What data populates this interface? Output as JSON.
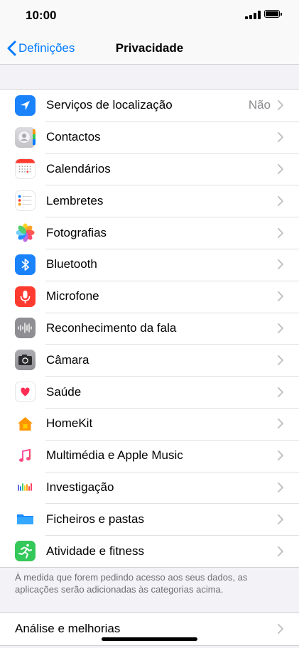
{
  "status_bar": {
    "time": "10:00"
  },
  "nav": {
    "back_label": "Definições",
    "title": "Privacidade"
  },
  "privacy_items": [
    {
      "id": "location",
      "label": "Serviços de localização",
      "value": "Não",
      "icon": "location-arrow-icon",
      "color": "#1a82fb"
    },
    {
      "id": "contacts",
      "label": "Contactos",
      "value": "",
      "icon": "contacts-icon",
      "color": "#cfcfd4"
    },
    {
      "id": "calendars",
      "label": "Calendários",
      "value": "",
      "icon": "calendar-icon",
      "color": "#ff3b30"
    },
    {
      "id": "reminders",
      "label": "Lembretes",
      "value": "",
      "icon": "reminders-icon",
      "color": "#ffffff"
    },
    {
      "id": "photos",
      "label": "Fotografias",
      "value": "",
      "icon": "photos-icon",
      "color": "#ffffff"
    },
    {
      "id": "bluetooth",
      "label": "Bluetooth",
      "value": "",
      "icon": "bluetooth-icon",
      "color": "#1a82fb"
    },
    {
      "id": "microphone",
      "label": "Microfone",
      "value": "",
      "icon": "microphone-icon",
      "color": "#ff3b30"
    },
    {
      "id": "speech",
      "label": "Reconhecimento da fala",
      "value": "",
      "icon": "waveform-icon",
      "color": "#8e8e93"
    },
    {
      "id": "camera",
      "label": "Câmara",
      "value": "",
      "icon": "camera-icon",
      "color": "#8e8e93"
    },
    {
      "id": "health",
      "label": "Saúde",
      "value": "",
      "icon": "heart-icon",
      "color": "#ffffff"
    },
    {
      "id": "homekit",
      "label": "HomeKit",
      "value": "",
      "icon": "home-icon",
      "color": "#ffffff"
    },
    {
      "id": "music",
      "label": "Multimédia e Apple Music",
      "value": "",
      "icon": "music-note-icon",
      "color": "#ffffff"
    },
    {
      "id": "research",
      "label": "Investigação",
      "value": "",
      "icon": "research-icon",
      "color": "#ffffff"
    },
    {
      "id": "files",
      "label": "Ficheiros e pastas",
      "value": "",
      "icon": "folder-icon",
      "color": "#ffffff"
    },
    {
      "id": "fitness",
      "label": "Atividade e fitness",
      "value": "",
      "icon": "fitness-runner-icon",
      "color": "#34c759"
    }
  ],
  "footer_note": "À medida que forem pedindo acesso aos seus dados, as aplicações serão adicionadas às categorias acima.",
  "bottom_items": [
    {
      "id": "analytics",
      "label": "Análise e melhorias"
    }
  ]
}
